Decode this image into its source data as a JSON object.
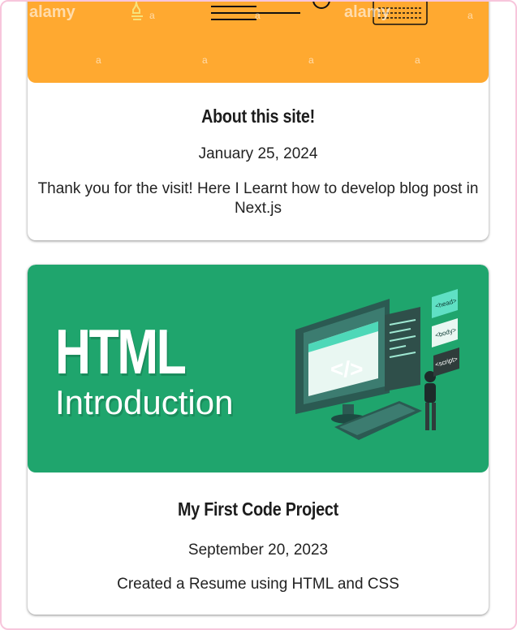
{
  "posts": [
    {
      "title": "About this site!",
      "date": "January 25, 2024",
      "description": "Thank you for the visit! Here I Learnt how to develop blog post in Next.js",
      "image": {
        "watermark": "alamy",
        "watermark_small": "a",
        "background": "#ffa930"
      }
    },
    {
      "title": "My First Code Project",
      "date": "September 20, 2023",
      "description": "Created a Resume using HTML and CSS",
      "image": {
        "headline": "HTML",
        "subline": "Introduction",
        "tags": [
          "<head>",
          "<body>",
          "<script>"
        ],
        "code_symbol": "</>",
        "background": "#1fa56d"
      }
    }
  ]
}
